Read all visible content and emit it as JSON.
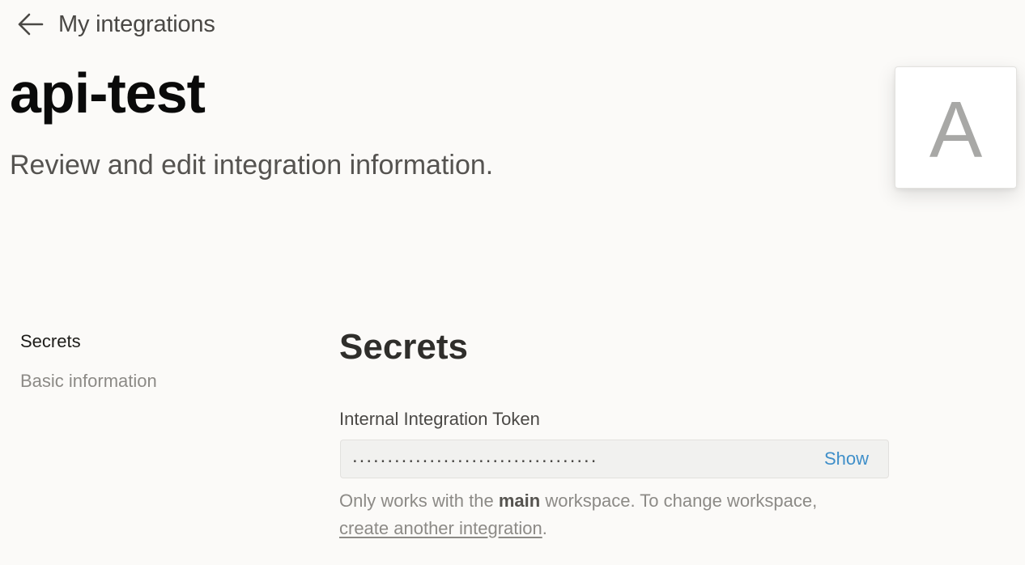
{
  "header": {
    "back_label": "My integrations",
    "title": "api-test",
    "subtitle": "Review and edit integration information."
  },
  "avatar": {
    "letter": "A"
  },
  "sidebar": {
    "items": [
      {
        "label": "Secrets",
        "active": true
      },
      {
        "label": "Basic information",
        "active": false
      }
    ]
  },
  "secrets": {
    "title": "Secrets",
    "token_label": "Internal Integration Token",
    "token_masked": "...................................",
    "show_label": "Show",
    "help_prefix": "Only works with the ",
    "help_workspace": "main",
    "help_middle": " workspace. To change workspace,",
    "help_link": "create another integration",
    "help_suffix": "."
  },
  "colors": {
    "background": "#fbfaf8",
    "link_blue": "#3f8fc9",
    "muted_text": "#8c8a86"
  },
  "icons": {
    "back": "arrow-left-icon"
  }
}
